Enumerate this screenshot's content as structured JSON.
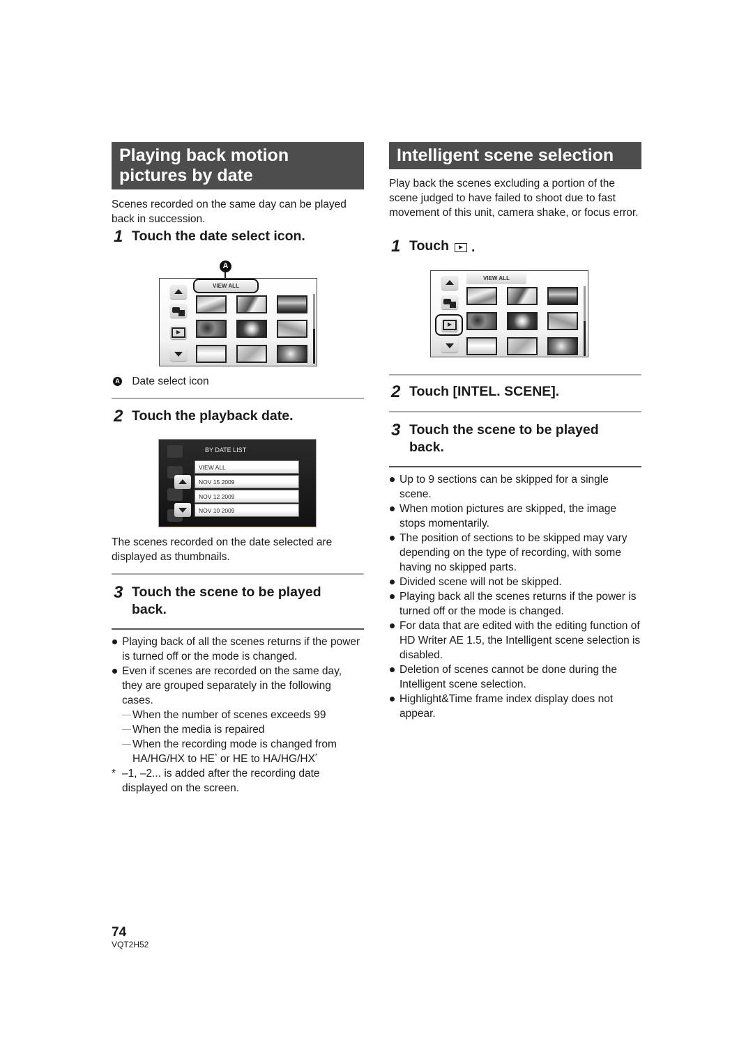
{
  "left": {
    "section_title_line1": "Playing back motion",
    "section_title_line2": "pictures by date",
    "intro": "Scenes recorded on the same day can be played back in succession.",
    "step1": {
      "num": "1",
      "text": "Touch the date select icon."
    },
    "screen1": {
      "view_all_label": "VIEW ALL",
      "callout_letter": "A",
      "icons": [
        "up-arrow-icon",
        "camera-icon",
        "play-icon",
        "down-arrow-icon"
      ]
    },
    "callout_caption_letter": "A",
    "callout_caption": "Date select icon",
    "step2": {
      "num": "2",
      "text": "Touch the playback date."
    },
    "screen2": {
      "header": "BY DATE LIST",
      "items": [
        "VIEW ALL",
        "NOV 15 2009",
        "NOV 12 2009",
        "NOV 10 2009"
      ]
    },
    "after_step2": "The scenes recorded on the date selected are displayed as thumbnails.",
    "step3": {
      "num": "3",
      "text_line1": "Touch the scene to be played",
      "text_line2": "back."
    },
    "bullets": [
      "Playing back of all the scenes returns if the power is turned off or the mode is changed.",
      "Even if scenes are recorded on the same day, they are grouped separately in the following cases."
    ],
    "dashes": [
      "When the number of scenes exceeds 99",
      "When the media is repaired",
      "When the recording mode is changed from"
    ],
    "dash3_cont_a": "HA/HG/HX to HE",
    "dash3_cont_b": " or HE to HA/HG/HX",
    "asterisk": "*",
    "footnote": "–1, –2... is added after the recording date displayed on the screen."
  },
  "right": {
    "section_title": "Intelligent scene selection",
    "intro": "Play back the scenes excluding a portion of the scene judged to have failed to shoot due to fast movement of this unit, camera shake, or focus error.",
    "step1": {
      "num": "1",
      "text": "Touch",
      "trail": "."
    },
    "screen": {
      "view_all_label": "VIEW ALL"
    },
    "step2": {
      "num": "2",
      "text": "Touch [INTEL. SCENE]."
    },
    "step3": {
      "num": "3",
      "text_line1": "Touch the scene to be played",
      "text_line2": "back."
    },
    "bullets": [
      "Up to 9 sections can be skipped for a single scene.",
      "When motion pictures are skipped, the image stops momentarily.",
      "The position of sections to be skipped may vary depending on the type of recording, with some having no skipped parts.",
      "Divided scene will not be skipped.",
      "Playing back all the scenes returns if the power is turned off or the mode is changed.",
      "For data that are edited with the editing function of HD Writer AE 1.5, the Intelligent scene selection is disabled.",
      "Deletion of scenes cannot be done during the Intelligent scene selection.",
      "Highlight&Time frame index display does not appear."
    ]
  },
  "footer": {
    "page_number": "74",
    "doc_code": "VQT2H52"
  }
}
